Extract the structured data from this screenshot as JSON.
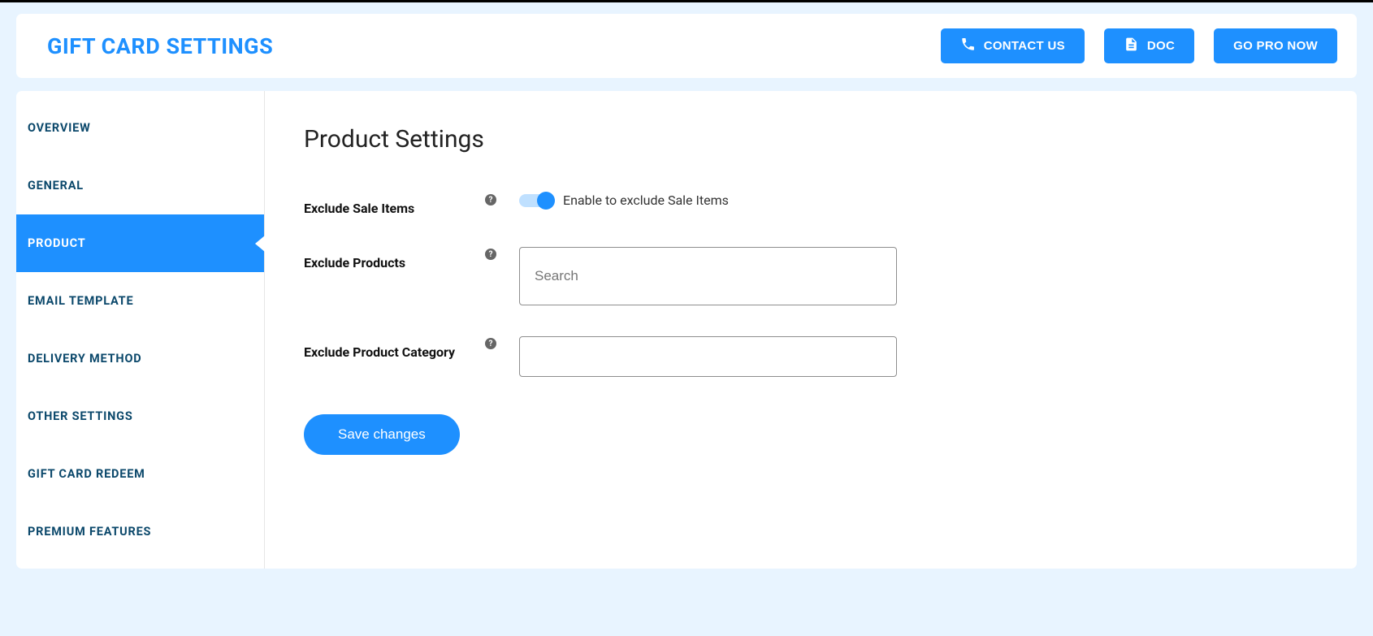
{
  "header": {
    "title": "GIFT CARD SETTINGS",
    "buttons": {
      "contact": "CONTACT US",
      "doc": "DOC",
      "gopro": "GO PRO NOW"
    }
  },
  "sidebar": {
    "items": [
      {
        "label": "OVERVIEW"
      },
      {
        "label": "GENERAL"
      },
      {
        "label": "PRODUCT"
      },
      {
        "label": "EMAIL TEMPLATE"
      },
      {
        "label": "DELIVERY METHOD"
      },
      {
        "label": "OTHER SETTINGS"
      },
      {
        "label": "GIFT CARD REDEEM"
      },
      {
        "label": "PREMIUM FEATURES"
      }
    ],
    "active_index": 2
  },
  "content": {
    "title": "Product Settings",
    "fields": {
      "exclude_sale_items": {
        "label": "Exclude Sale Items",
        "description": "Enable to exclude Sale Items",
        "enabled": true
      },
      "exclude_products": {
        "label": "Exclude Products",
        "placeholder": "Search",
        "value": ""
      },
      "exclude_product_category": {
        "label": "Exclude Product Category",
        "value": ""
      }
    },
    "save_label": "Save changes"
  }
}
